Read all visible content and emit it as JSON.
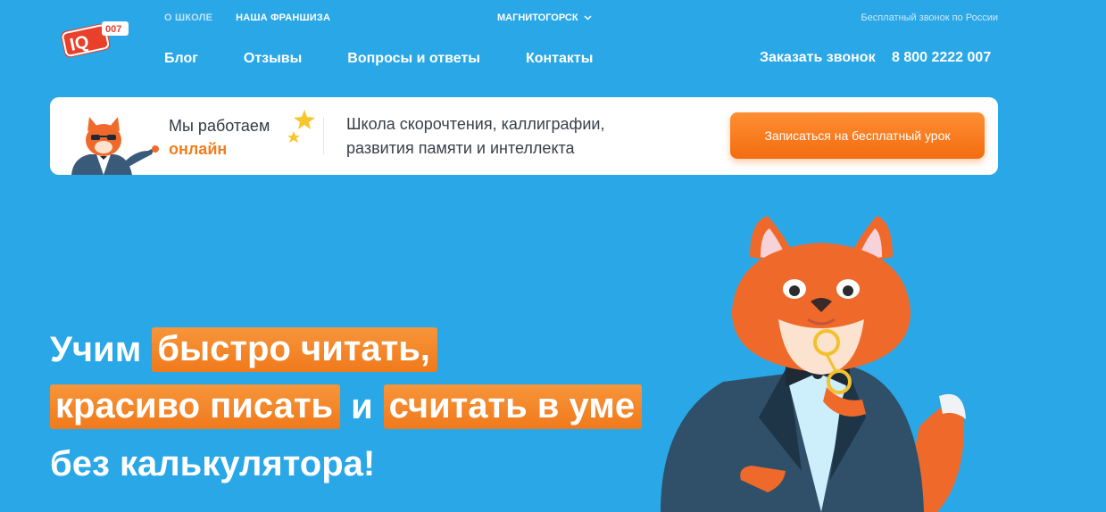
{
  "logo": {
    "text": "IQ",
    "badge": "007"
  },
  "top_nav": [
    {
      "label": "О ШКОЛЕ",
      "muted": true
    },
    {
      "label": "НАША ФРАНШИЗА",
      "muted": false
    }
  ],
  "city": {
    "label": "МАГНИТОГОРСК",
    "icon": "chevron-down-icon"
  },
  "free_call_note": "Бесплатный звонок по России",
  "main_nav": [
    "Блог",
    "Отзывы",
    "Вопросы и ответы",
    "Контакты"
  ],
  "order_call": "Заказать звонок",
  "phone": "8 800 2222 007",
  "banner": {
    "online_line1": "Мы работаем",
    "online_line2": "онлайн",
    "slogan": "Школа скорочтения, каллиграфии, развития памяти и интеллекта",
    "cta": "Записаться на бесплатный урок"
  },
  "hero": {
    "l1_plain": "Учим",
    "l1_hl": "быстро читать,",
    "l2_hl1": "красиво писать",
    "l2_plain": "и",
    "l2_hl2": "считать в уме",
    "l3": "без калькулятора!"
  },
  "colors": {
    "background": "#2aa7e6",
    "accent": "#f47d1b",
    "text_dark": "#333b45"
  }
}
